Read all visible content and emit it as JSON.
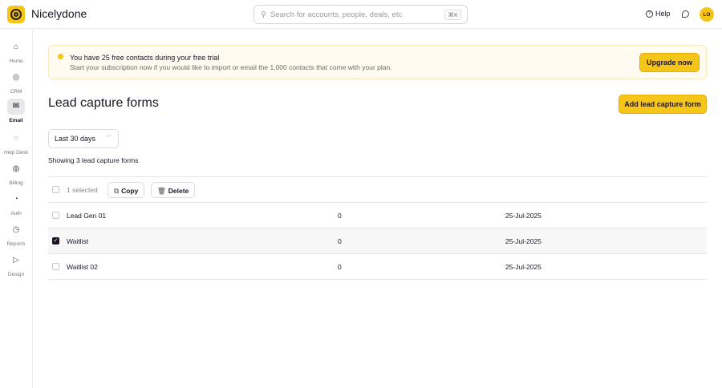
{
  "header": {
    "brand": "Nicelydone",
    "search_placeholder": "Search for accounts, people, deals, etc",
    "shortcut": "⌘K",
    "help": "Help",
    "avatar": "LO"
  },
  "sidebar": {
    "items": [
      {
        "label": "Home",
        "icon": "⌂"
      },
      {
        "label": "CRM",
        "icon": "◎"
      },
      {
        "label": "Email",
        "icon": "✉"
      },
      {
        "label": "Help Desk",
        "icon": "◌"
      },
      {
        "label": "Billing",
        "icon": "◍"
      },
      {
        "label": "Auth",
        "icon": "◔"
      },
      {
        "label": "Reports",
        "icon": "◷"
      },
      {
        "label": "Design",
        "icon": "▷"
      }
    ]
  },
  "banner": {
    "title": "You have 25 free contacts during your free trial",
    "text": "Start your subscription now if you would like to import or email the 1,000 contacts that come with your plan.",
    "button": "Upgrade now"
  },
  "page": {
    "title": "Lead capture forms",
    "add_button": "Add lead capture form",
    "date_filter": "Last 30 days",
    "showing": "Showing 3 lead capture forms"
  },
  "toolbar": {
    "selected": "1 selected",
    "copy": "Copy",
    "delete": "Delete"
  },
  "rows": [
    {
      "name": "Lead Gen 01",
      "count": "0",
      "date": "25-Jul-2025",
      "checked": false
    },
    {
      "name": "Waitlist",
      "count": "0",
      "date": "25-Jul-2025",
      "checked": true
    },
    {
      "name": "Waitlist 02",
      "count": "0",
      "date": "25-Jul-2025",
      "checked": false
    }
  ]
}
